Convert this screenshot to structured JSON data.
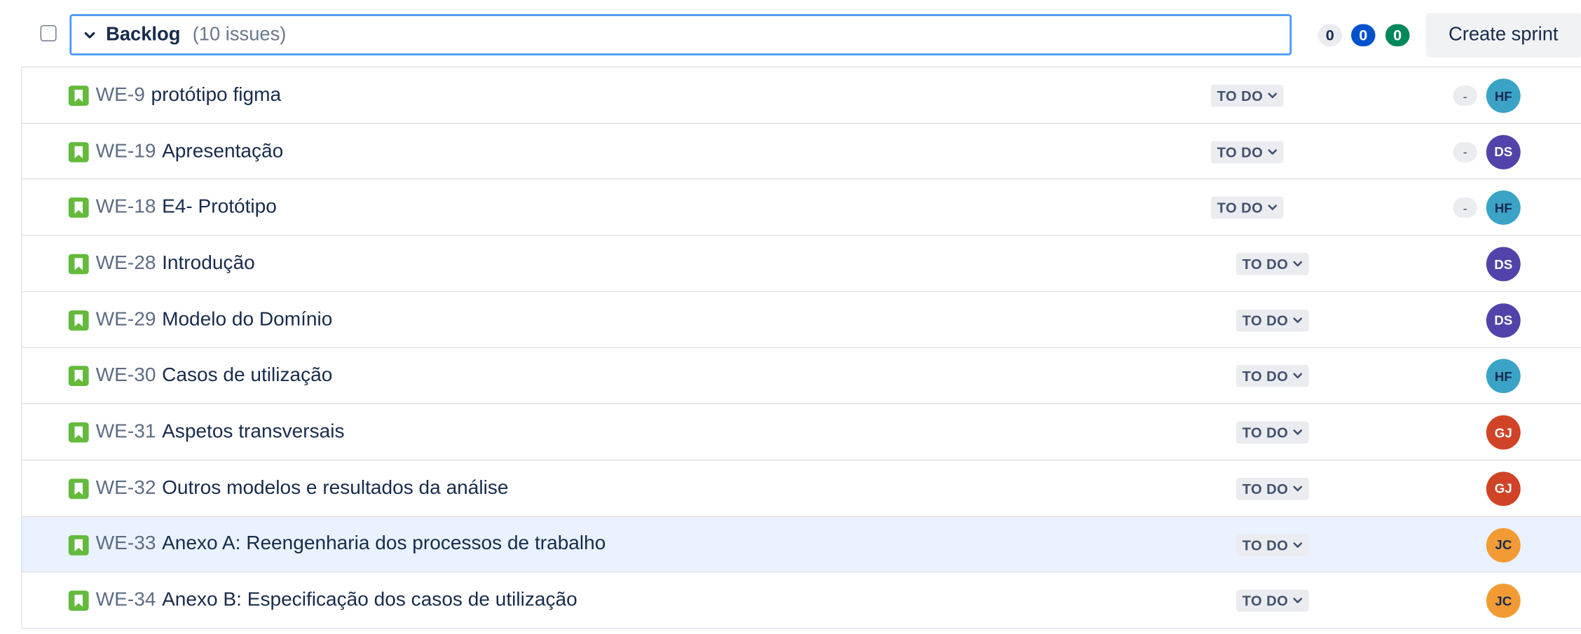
{
  "header": {
    "title": "Backlog",
    "count": "(10 issues)",
    "counts": {
      "todo": "0",
      "in_progress": "0",
      "done": "0"
    },
    "create_sprint_label": "Create sprint"
  },
  "colors": {
    "story": "#63ba3c",
    "selected_row": "#e9f2fe",
    "focus_border": "#4c9aff",
    "in_progress_badge": "#0052cc",
    "done_badge": "#00875a"
  },
  "issues": [
    {
      "key": "WE-9",
      "summary": "protótipo figma",
      "status": "TO DO",
      "estimate": "-",
      "assignee": "HF",
      "avatar_bg": "#3ba3c6",
      "avatar_fg": "#172b4d",
      "selected": false
    },
    {
      "key": "WE-19",
      "summary": "Apresentação",
      "status": "TO DO",
      "estimate": "-",
      "assignee": "DS",
      "avatar_bg": "#5243aa",
      "avatar_fg": "#ffffff",
      "selected": false
    },
    {
      "key": "WE-18",
      "summary": "E4- Protótipo",
      "status": "TO DO",
      "estimate": "-",
      "assignee": "HF",
      "avatar_bg": "#3ba3c6",
      "avatar_fg": "#172b4d",
      "selected": false
    },
    {
      "key": "WE-28",
      "summary": "Introdução",
      "status": "TO DO",
      "estimate": null,
      "assignee": "DS",
      "avatar_bg": "#5243aa",
      "avatar_fg": "#ffffff",
      "selected": false
    },
    {
      "key": "WE-29",
      "summary": "Modelo do Domínio",
      "status": "TO DO",
      "estimate": null,
      "assignee": "DS",
      "avatar_bg": "#5243aa",
      "avatar_fg": "#ffffff",
      "selected": false
    },
    {
      "key": "WE-30",
      "summary": "Casos de utilização",
      "status": "TO DO",
      "estimate": null,
      "assignee": "HF",
      "avatar_bg": "#3ba3c6",
      "avatar_fg": "#172b4d",
      "selected": false
    },
    {
      "key": "WE-31",
      "summary": "Aspetos transversais",
      "status": "TO DO",
      "estimate": null,
      "assignee": "GJ",
      "avatar_bg": "#d04326",
      "avatar_fg": "#ffffff",
      "selected": false
    },
    {
      "key": "WE-32",
      "summary": "Outros modelos e resultados da análise",
      "status": "TO DO",
      "estimate": null,
      "assignee": "GJ",
      "avatar_bg": "#d04326",
      "avatar_fg": "#ffffff",
      "selected": false
    },
    {
      "key": "WE-33",
      "summary": "Anexo A: Reengenharia dos processos de trabalho",
      "status": "TO DO",
      "estimate": null,
      "assignee": "JC",
      "avatar_bg": "#f29b35",
      "avatar_fg": "#172b4d",
      "selected": true
    },
    {
      "key": "WE-34",
      "summary": "Anexo B: Especificação dos casos de utilização",
      "status": "TO DO",
      "estimate": null,
      "assignee": "JC",
      "avatar_bg": "#f29b35",
      "avatar_fg": "#172b4d",
      "selected": false
    }
  ]
}
